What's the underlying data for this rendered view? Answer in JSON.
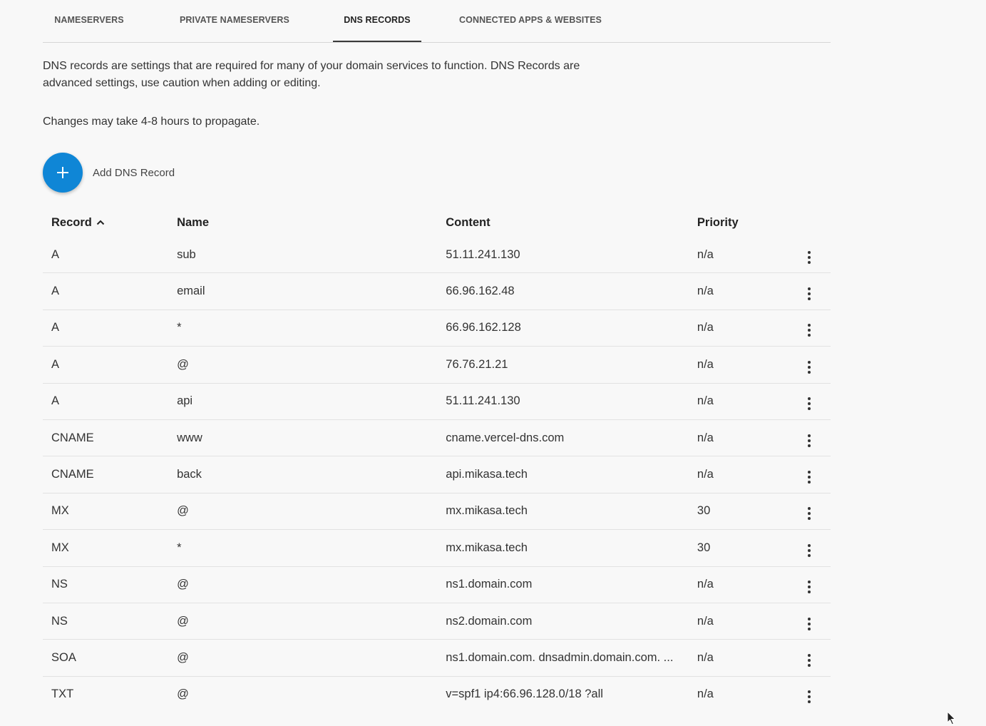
{
  "tabs": [
    {
      "label": "NAMESERVERS",
      "active": false
    },
    {
      "label": "PRIVATE NAMESERVERS",
      "active": false
    },
    {
      "label": "DNS RECORDS",
      "active": true
    },
    {
      "label": "CONNECTED APPS & WEBSITES",
      "active": false
    }
  ],
  "intro_text": "DNS records are settings that are required for many of your domain services to function. DNS Records are advanced settings, use caution when adding or editing.",
  "propagation_text": "Changes may take 4-8 hours to propagate.",
  "add_button": {
    "icon": "plus-icon",
    "label": "Add DNS Record",
    "color": "#0f86d6"
  },
  "table": {
    "headers": {
      "record": "Record",
      "name": "Name",
      "content": "Content",
      "priority": "Priority"
    },
    "sort": {
      "column": "record",
      "direction": "ascending",
      "icon": "chevron-up-icon"
    },
    "rows": [
      {
        "record": "A",
        "name": "sub",
        "content": "51.11.241.130",
        "priority": "n/a"
      },
      {
        "record": "A",
        "name": "email",
        "content": "66.96.162.48",
        "priority": "n/a"
      },
      {
        "record": "A",
        "name": "*",
        "content": "66.96.162.128",
        "priority": "n/a"
      },
      {
        "record": "A",
        "name": "@",
        "content": "76.76.21.21",
        "priority": "n/a"
      },
      {
        "record": "A",
        "name": "api",
        "content": "51.11.241.130",
        "priority": "n/a"
      },
      {
        "record": "CNAME",
        "name": "www",
        "content": "cname.vercel-dns.com",
        "priority": "n/a"
      },
      {
        "record": "CNAME",
        "name": "back",
        "content": "api.mikasa.tech",
        "priority": "n/a"
      },
      {
        "record": "MX",
        "name": "@",
        "content": "mx.mikasa.tech",
        "priority": "30"
      },
      {
        "record": "MX",
        "name": "*",
        "content": "mx.mikasa.tech",
        "priority": "30"
      },
      {
        "record": "NS",
        "name": "@",
        "content": "ns1.domain.com",
        "priority": "n/a"
      },
      {
        "record": "NS",
        "name": "@",
        "content": "ns2.domain.com",
        "priority": "n/a"
      },
      {
        "record": "SOA",
        "name": "@",
        "content": "ns1.domain.com. dnsadmin.domain.com. ...",
        "priority": "n/a"
      },
      {
        "record": "TXT",
        "name": "@",
        "content": "v=spf1 ip4:66.96.128.0/18 ?all",
        "priority": "n/a"
      }
    ],
    "row_menu_icon": "more-vertical-icon"
  }
}
